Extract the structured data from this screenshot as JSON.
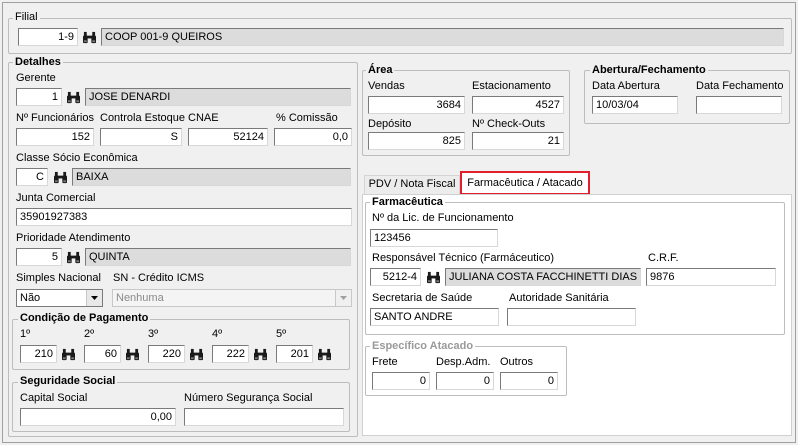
{
  "filial": {
    "title": "Filial",
    "code": "1-9",
    "name": "COOP 001-9  QUEIROS"
  },
  "detalhes": {
    "title": "Detalhes",
    "gerente": {
      "label": "Gerente",
      "code": "1",
      "name": "JOSE DENARDI"
    },
    "funcionarios": {
      "label": "Nº Funcionários",
      "value": "152"
    },
    "controla_estoque": {
      "label": "Controla Estoque",
      "value": "S"
    },
    "cnae": {
      "label": "CNAE",
      "value": "52124"
    },
    "comissao": {
      "label": "% Comissão",
      "value": "0,0"
    },
    "classe": {
      "label": "Classe Sócio Econômica",
      "code": "C",
      "name": "BAIXA"
    },
    "junta": {
      "label": "Junta Comercial",
      "value": "35901927383"
    },
    "prioridade": {
      "label": "Prioridade Atendimento",
      "code": "5",
      "name": "QUINTA"
    },
    "simples": {
      "label": "Simples Nacional",
      "value": "Não"
    },
    "sn_credito": {
      "label": "SN - Crédito ICMS",
      "value": "Nenhuma"
    }
  },
  "pagamento": {
    "title": "Condição de Pagamento",
    "items": [
      {
        "label": "1º",
        "value": "210"
      },
      {
        "label": "2º",
        "value": "60"
      },
      {
        "label": "3º",
        "value": "220"
      },
      {
        "label": "4º",
        "value": "222"
      },
      {
        "label": "5º",
        "value": "201"
      }
    ]
  },
  "seguridade": {
    "title": "Seguridade Social",
    "capital": {
      "label": "Capital Social",
      "value": "0,00"
    },
    "numero": {
      "label": "Número Segurança Social",
      "value": ""
    }
  },
  "area": {
    "title": "Área",
    "vendas": {
      "label": "Vendas",
      "value": "3684"
    },
    "estacionamento": {
      "label": "Estacionamento",
      "value": "4527"
    },
    "deposito": {
      "label": "Depósito",
      "value": "825"
    },
    "checkouts": {
      "label": "Nº Check-Outs",
      "value": "21"
    }
  },
  "abertura": {
    "title": "Abertura/Fechamento",
    "abertura": {
      "label": "Data Abertura",
      "value": "10/03/04"
    },
    "fechamento": {
      "label": "Data Fechamento",
      "value": ""
    }
  },
  "tabs": {
    "pdv": "PDV / Nota Fiscal",
    "farma": "Farmacêutica / Atacado"
  },
  "farmaceutica": {
    "title": "Farmacêutica",
    "licenca": {
      "label": "Nº da Lic. de Funcionamento",
      "value": "123456"
    },
    "responsavel": {
      "label": "Responsável Técnico (Farmáceutico)",
      "code": "5212-4",
      "name": "JULIANA COSTA FACCHINETTI DIAS"
    },
    "crf": {
      "label": "C.R.F.",
      "value": "9876"
    },
    "secretaria": {
      "label": "Secretaria de Saúde",
      "value": "SANTO ANDRE"
    },
    "autoridade": {
      "label": "Autoridade Sanitária",
      "value": ""
    }
  },
  "atacado": {
    "title": "Específico Atacado",
    "frete": {
      "label": "Frete",
      "value": "0"
    },
    "despadm": {
      "label": "Desp.Adm.",
      "value": "0"
    },
    "outros": {
      "label": "Outros",
      "value": "0"
    }
  },
  "colors": {
    "highlight": "#e0202a",
    "binoculars": "#1a1a1a"
  }
}
